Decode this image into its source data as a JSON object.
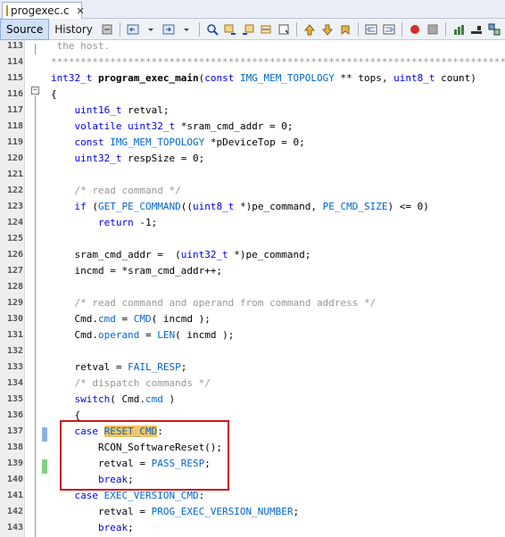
{
  "file_tab": {
    "name": "progexec.c",
    "close": "✕"
  },
  "toolbar": {
    "source_label": "Source",
    "history_label": "History",
    "icons": [
      "back-icon",
      "forward-icon",
      "find-icon",
      "find-prev-icon",
      "find-next-icon",
      "toggle-highlight-icon",
      "toggle-bookmark-icon",
      "prev-bookmark-icon",
      "next-bookmark-icon",
      "shift-left-icon",
      "shift-right-icon",
      "record-macro-icon",
      "stop-macro-icon",
      "chart-icon",
      "diff-icon"
    ]
  },
  "lines": [
    {
      "n": "113",
      "t": " the host."
    },
    {
      "n": "114",
      "t": "*******************************************************************************/"
    },
    {
      "n": "115",
      "t": "int32_t program_exec_main(const IMG_MEM_TOPOLOGY ** tops, uint8_t count)"
    },
    {
      "n": "116",
      "t": "{"
    },
    {
      "n": "117",
      "t": "    uint16_t retval;"
    },
    {
      "n": "118",
      "t": "    volatile uint32_t *sram_cmd_addr = 0;"
    },
    {
      "n": "119",
      "t": "    const IMG_MEM_TOPOLOGY *pDeviceTop = 0;"
    },
    {
      "n": "120",
      "t": "    uint32_t respSize = 0;"
    },
    {
      "n": "121",
      "t": ""
    },
    {
      "n": "122",
      "t": "    /* read command */"
    },
    {
      "n": "123",
      "t": "    if (GET_PE_COMMAND((uint8_t *)pe_command, PE_CMD_SIZE) <= 0)"
    },
    {
      "n": "124",
      "t": "        return -1;"
    },
    {
      "n": "125",
      "t": ""
    },
    {
      "n": "126",
      "t": "    sram_cmd_addr =  (uint32_t *)pe_command;"
    },
    {
      "n": "127",
      "t": "    incmd = *sram_cmd_addr++;"
    },
    {
      "n": "128",
      "t": ""
    },
    {
      "n": "129",
      "t": "    /* read command and operand from command address */"
    },
    {
      "n": "130",
      "t": "    Cmd.cmd = CMD( incmd );"
    },
    {
      "n": "131",
      "t": "    Cmd.operand = LEN( incmd );"
    },
    {
      "n": "132",
      "t": ""
    },
    {
      "n": "133",
      "t": "    retval = FAIL_RESP;"
    },
    {
      "n": "134",
      "t": "    /* dispatch commands */"
    },
    {
      "n": "135",
      "t": "    switch( Cmd.cmd )"
    },
    {
      "n": "136",
      "t": "    {"
    },
    {
      "n": "137",
      "t": "    case RESET_CMD:"
    },
    {
      "n": "138",
      "t": "        RCON_SoftwareReset();"
    },
    {
      "n": "139",
      "t": "        retval = PASS_RESP;"
    },
    {
      "n": "140",
      "t": "        break;"
    },
    {
      "n": "141",
      "t": "    case EXEC_VERSION_CMD:"
    },
    {
      "n": "142",
      "t": "        retval = PROG_EXEC_VERSION_NUMBER;"
    },
    {
      "n": "143",
      "t": "        break;"
    }
  ],
  "colors": {
    "keyword": "#0000e6",
    "comment": "#969696",
    "macro": "#0066cc",
    "highlight": "#f4c361",
    "callout_border": "#c8191e",
    "change_marker_blue": "#8fb1e6",
    "change_marker_green": "#7fd07f"
  }
}
